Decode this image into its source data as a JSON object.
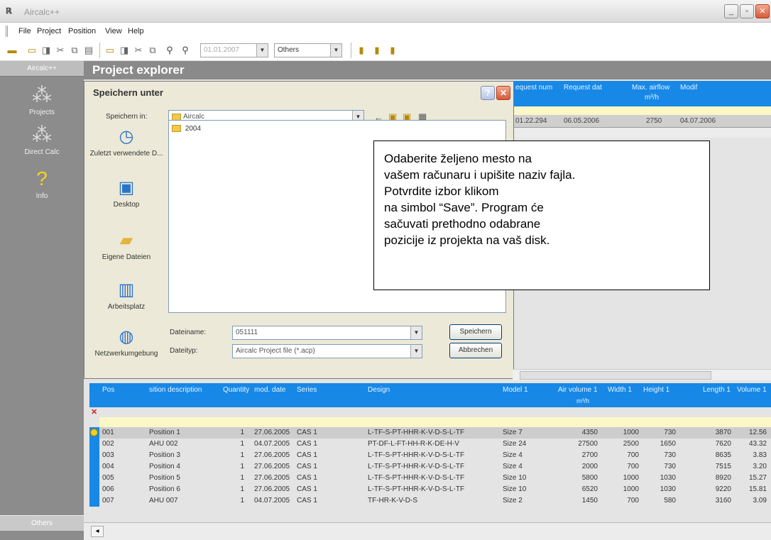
{
  "window": {
    "title": "Aircalc++",
    "controls": [
      "minimize-icon",
      "maximize-icon",
      "close-icon"
    ]
  },
  "menu": {
    "items": [
      "File",
      "Project",
      "Position",
      "View",
      "Help"
    ]
  },
  "toolbar": {
    "date_value": "01.01.2007",
    "others_value": "Others"
  },
  "sidebar": {
    "header": "Aircalc++",
    "items": [
      {
        "label": "Projects",
        "icon": "projects-icon"
      },
      {
        "label": "Direct Calc",
        "icon": "direct-calc-icon"
      },
      {
        "label": "Info",
        "icon": "info-icon"
      }
    ],
    "footer": "Others"
  },
  "explorer": {
    "title": "Project explorer"
  },
  "top_table": {
    "headers": [
      "equest num",
      "Request dat",
      "Max. airflow",
      "Modif"
    ],
    "unit": "m³/h",
    "row": [
      "01.22.294",
      "06.05.2006",
      "2750",
      "04.07.2006"
    ]
  },
  "dialog": {
    "title": "Speichern unter",
    "save_in_label": "Speichern in:",
    "save_in_value": "Aircalc",
    "folder_items": [
      "2004"
    ],
    "places": [
      {
        "label": "Zuletzt verwendete D...",
        "icon": "recent-icon"
      },
      {
        "label": "Desktop",
        "icon": "desktop-icon"
      },
      {
        "label": "Eigene Dateien",
        "icon": "my-documents-icon"
      },
      {
        "label": "Arbeitsplatz",
        "icon": "my-computer-icon"
      },
      {
        "label": "Netzwerkumgebung",
        "icon": "network-icon"
      }
    ],
    "filename_label": "Dateiname:",
    "filename_value": "051111",
    "filetype_label": "Dateityp:",
    "filetype_value": "Aircalc Project file (*.acp)",
    "save_button": "Speichern",
    "cancel_button": "Abbrechen"
  },
  "callout": {
    "lines": [
      "Odaberite željeno mesto na",
      "vašem računaru i upišite naziv fajla.",
      "Potvrdite izbor klikom",
      "na simbol “Save”. Program će",
      "sačuvati prethodno odabrane",
      "pozicije iz projekta na vaš disk."
    ]
  },
  "bottom_table": {
    "headers": [
      "Pos",
      "sition description",
      "Quantity",
      "mod. date",
      "Series",
      "Design",
      "Model 1",
      "Air volume 1",
      "Width 1",
      "Height 1",
      "Length 1",
      "Volume 1"
    ],
    "air_unit": "m³/h",
    "rows": [
      [
        "001",
        "Position 1",
        "1",
        "27.06.2005",
        "CAS 1",
        "L-TF-S-PT-HHR-K-V-D-S-L-TF",
        "Size 7",
        "4350",
        "1000",
        "730",
        "3870",
        "12.56"
      ],
      [
        "002",
        "AHU 002",
        "1",
        "04.07.2005",
        "CAS 1",
        "PT-DF-L-FT-HH-R-K-DE-H-V",
        "Size 24",
        "27500",
        "2500",
        "1650",
        "7620",
        "43.32"
      ],
      [
        "003",
        "Position 3",
        "1",
        "27.06.2005",
        "CAS 1",
        "L-TF-S-PT-HHR-K-V-D-S-L-TF",
        "Size 4",
        "2700",
        "700",
        "730",
        "8635",
        "3.83"
      ],
      [
        "004",
        "Position 4",
        "1",
        "27.06.2005",
        "CAS 1",
        "L-TF-S-PT-HHR-K-V-D-S-L-TF",
        "Size 4",
        "2000",
        "700",
        "730",
        "7515",
        "3.20"
      ],
      [
        "005",
        "Position 5",
        "1",
        "27.06.2005",
        "CAS 1",
        "L-TF-S-PT-HHR-K-V-D-S-L-TF",
        "Size 10",
        "5800",
        "1000",
        "1030",
        "8920",
        "15.27"
      ],
      [
        "006",
        "Position 6",
        "1",
        "27.06.2005",
        "CAS 1",
        "L-TF-S-PT-HHR-K-V-D-S-L-TF",
        "Size 10",
        "6520",
        "1000",
        "1030",
        "9220",
        "15.81"
      ],
      [
        "007",
        "AHU 007",
        "1",
        "04.07.2005",
        "CAS 1",
        "TF-HR-K-V-D-S",
        "Size 2",
        "1450",
        "700",
        "580",
        "3160",
        "3.09"
      ]
    ]
  }
}
